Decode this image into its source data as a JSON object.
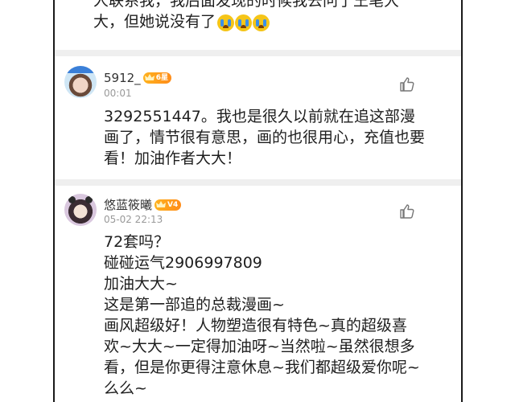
{
  "top_comment": {
    "line1": "人联系我，我后面发现的时候我去问了王笔大",
    "line2": "大，但她说没有了"
  },
  "comments": [
    {
      "username": "5912_",
      "badge": "6星",
      "timestamp": "00:01",
      "lines": [
        "3292551447。我也是很久以前就在追这部漫",
        "画了，情节很有意思，画的也很用心，充值也要",
        "看！加油作者大大！"
      ]
    },
    {
      "username": "悠蓝筱曦",
      "badge": "V4",
      "timestamp": "05-02 22:13",
      "lines": [
        "72套吗？",
        "碰碰运气2906997809",
        "加油大大~",
        "这是第一部追的总裁漫画~",
        "画风超级好！人物塑造很有特色~真的超级喜",
        "欢~大大~一定得加油呀~当然啦~虽然很想多",
        "看，但是你更得注意休息~我们都超级爱你呢~",
        "么么~"
      ]
    }
  ],
  "colors": {
    "crown_badge": "#ff9d1c",
    "divider": "#efefef",
    "timestamp": "#999999"
  },
  "icons": {
    "like": "thumb-up-icon",
    "crown": "crown-icon",
    "cry_emoji": "loudly-crying-emoji"
  }
}
